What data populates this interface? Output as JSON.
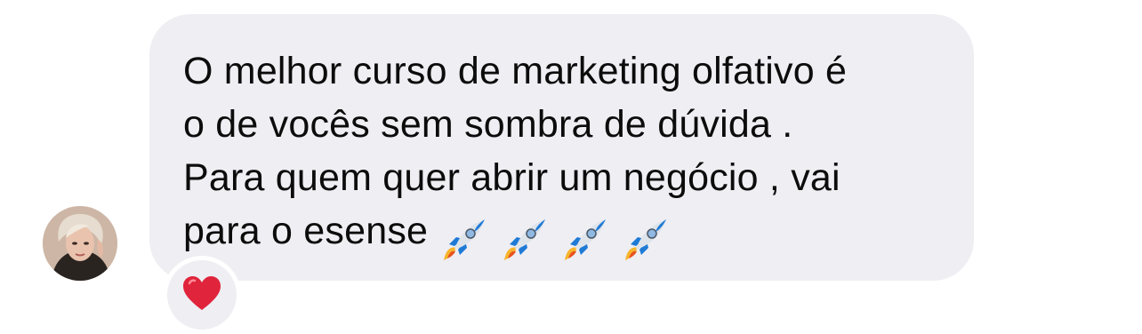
{
  "message": {
    "lines": [
      "O melhor curso de marketing olfativo é",
      "o de vocês sem sombra de dúvida .",
      "Para quem quer abrir um negócio , vai",
      "para o esense"
    ],
    "trailing_emoji": [
      "rocket",
      "rocket",
      "rocket",
      "rocket"
    ]
  },
  "reaction": {
    "emoji": "red-heart",
    "color": "#e0243b"
  },
  "colors": {
    "bubble": "#eeeef3",
    "text": "#0c0c0c",
    "background": "#ffffff"
  }
}
